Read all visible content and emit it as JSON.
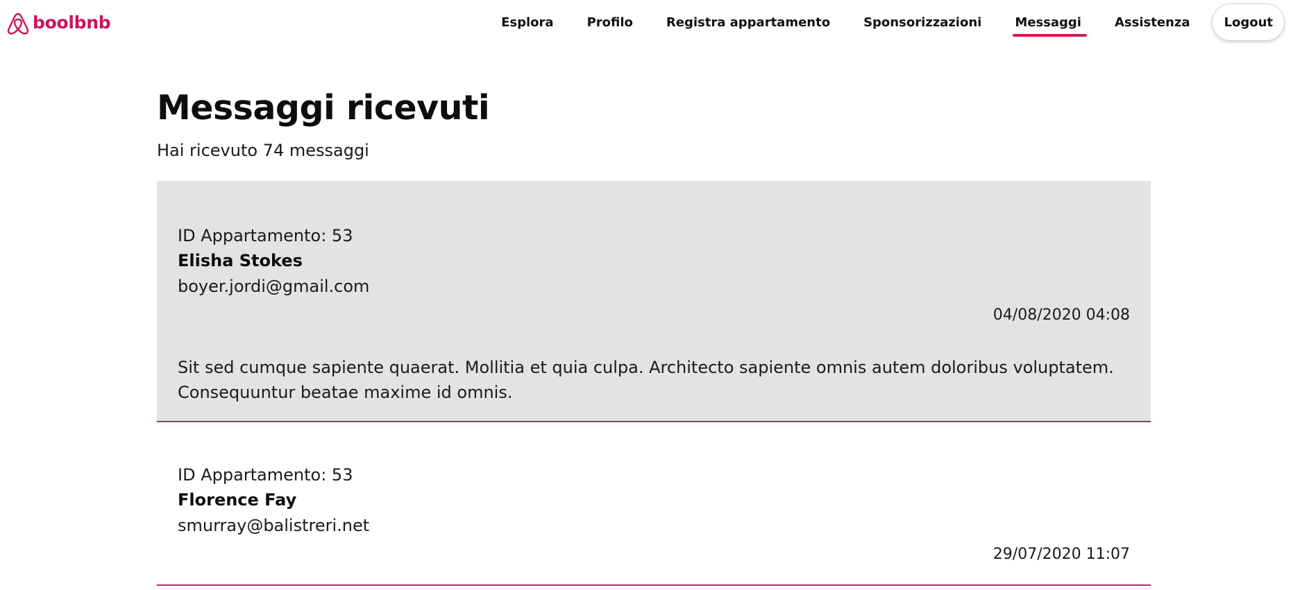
{
  "brand": {
    "name": "boolbnb",
    "color": "#c8145a",
    "icon": "airbnb-belo-logo-icon"
  },
  "nav": {
    "items": [
      {
        "label": "Esplora"
      },
      {
        "label": "Profilo"
      },
      {
        "label": "Registra appartamento"
      },
      {
        "label": "Sponsorizzazioni"
      },
      {
        "label": "Messaggi",
        "active": true
      },
      {
        "label": "Assistenza"
      }
    ],
    "logout_label": "Logout",
    "active_underline_color": "#d81b48"
  },
  "page": {
    "title": "Messaggi ricevuti",
    "subtitle": "Hai ricevuto 74 messaggi"
  },
  "messages": [
    {
      "apartment": "ID Appartamento: 53",
      "name": "Elisha Stokes",
      "email": "boyer.jordi@gmail.com",
      "date": "04/08/2020 04:08",
      "body": "Sit sed cumque sapiente quaerat. Mollitia et quia culpa. Architecto sapiente omnis autem doloribus voluptatem. Consequuntur beatae maxime id omnis.",
      "highlighted": true
    },
    {
      "apartment": "ID Appartamento: 53",
      "name": "Florence Fay",
      "email": "smurray@balistreri.net",
      "date": "29/07/2020 11:07",
      "body": "",
      "highlighted": false
    }
  ],
  "colors": {
    "accent": "#d81b5a",
    "highlight_bg": "#e3e3e3"
  }
}
